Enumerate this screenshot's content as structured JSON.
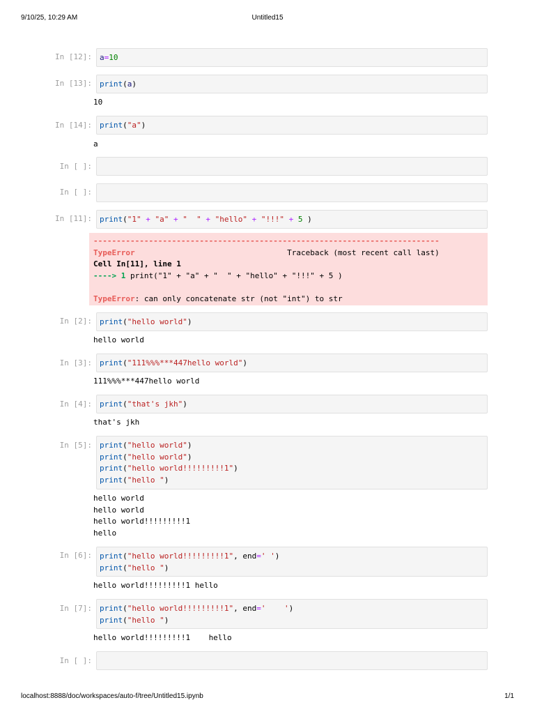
{
  "header": {
    "datetime": "9/10/25, 10:29 AM",
    "title": "Untitled15"
  },
  "footer": {
    "url": "localhost:8888/doc/workspaces/auto-f/tree/Untitled15.ipynb",
    "page": "1/1"
  },
  "cells": [
    {
      "prompt": "In [12]:",
      "code": "a=10"
    },
    {
      "prompt": "In [13]:",
      "code": "print(a)",
      "output": "10"
    },
    {
      "prompt": "In [14]:",
      "code": "print(\"a\")",
      "output": "a"
    },
    {
      "prompt": "In [ ]:",
      "code": ""
    },
    {
      "prompt": "In [ ]:",
      "code": ""
    },
    {
      "prompt": "In [11]:",
      "code": "print(\"1\" + \"a\" + \"  \" + \"hello\" + \"!!!\" + 5 )",
      "error": {
        "dashes": "---------------------------------------------------------------------------",
        "ename": "TypeError",
        "traceback": "Traceback (most recent call last)",
        "cell_ref": "Cell In[11], line 1",
        "arrow": "----> 1 ",
        "arrow_code": "print(\"1\" + \"a\" + \"  \" + \"hello\" + \"!!!\" + 5 )",
        "message": ": can only concatenate str (not \"int\") to str"
      }
    },
    {
      "prompt": "In [2]:",
      "code": "print(\"hello world\")",
      "output": "hello world"
    },
    {
      "prompt": "In [3]:",
      "code": "print(\"111%%%***447hello world\")",
      "output": "111%%%***447hello world"
    },
    {
      "prompt": "In [4]:",
      "code": "print(\"that's jkh\")",
      "output": "that's jkh"
    },
    {
      "prompt": "In [5]:",
      "code": "print(\"hello world\")\nprint(\"hello world\")\nprint(\"hello world!!!!!!!!!1\")\nprint(\"hello \")",
      "output": "hello world\nhello world\nhello world!!!!!!!!!1\nhello"
    },
    {
      "prompt": "In [6]:",
      "code": "print(\"hello world!!!!!!!!!1\", end=' ')\nprint(\"hello \")",
      "output": "hello world!!!!!!!!!1 hello"
    },
    {
      "prompt": "In [7]:",
      "code": "print(\"hello world!!!!!!!!!1\", end='    ')\nprint(\"hello \")",
      "output": "hello world!!!!!!!!!1    hello"
    },
    {
      "prompt": "In [ ]:",
      "code": ""
    }
  ]
}
